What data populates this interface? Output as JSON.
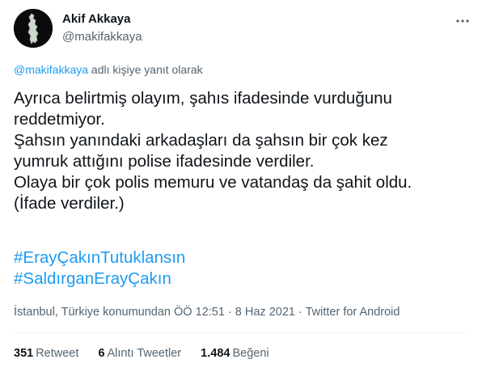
{
  "author": {
    "display_name": "Akif Akkaya",
    "handle": "@makifakkaya"
  },
  "reply": {
    "mention": "@makifakkaya",
    "suffix": " adlı kişiye yanıt olarak"
  },
  "body": {
    "lines": [
      "Ayrıca belirtmiş olayım, şahıs ifadesinde vurduğunu",
      "reddetmiyor.",
      "Şahsın yanındaki arkadaşları da şahsın bir çok kez",
      "yumruk attığını polise ifadesinde verdiler.",
      "Olaya bir çok polis memuru ve vatandaş da şahit oldu.",
      "(İfade verdiler.)"
    ],
    "hashtags": [
      "#ErayÇakınTutuklansın",
      "#SaldırganErayÇakın"
    ]
  },
  "meta": {
    "location": "İstanbul, Türkiye konumundan",
    "time": "ÖÖ 12:51",
    "sep1": " · ",
    "date": "8 Haz 2021",
    "sep2": " · ",
    "source": "Twitter for Android"
  },
  "stats": {
    "retweets": {
      "count": "351",
      "label": "Retweet"
    },
    "quotes": {
      "count": "6",
      "label": "Alıntı Tweetler"
    },
    "likes": {
      "count": "1.484",
      "label": "Beğeni"
    }
  },
  "icons": {
    "avatar": "map-silhouette-avatar",
    "more": "more-horizontal-icon"
  },
  "colors": {
    "link": "#1d9bf0",
    "secondary": "#536471",
    "text": "#0f1419",
    "divider": "#eff3f4"
  }
}
